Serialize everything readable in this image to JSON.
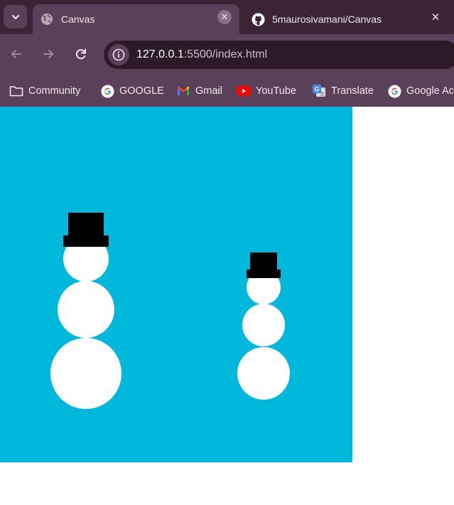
{
  "browser": {
    "tab_search_icon": "chevron-down-icon",
    "tabs": [
      {
        "title": "Canvas",
        "icon": "globe-icon",
        "active": true
      },
      {
        "title": "5maurosivamani/Canvas",
        "icon": "github-icon",
        "active": false
      }
    ],
    "toolbar": {
      "url_host": "127.0.0.1",
      "url_rest": ":5500/index.html"
    },
    "bookmarks": [
      {
        "label": "Community",
        "icon": "folder-icon"
      },
      {
        "label": "GOOGLE",
        "icon": "google-icon"
      },
      {
        "label": "Gmail",
        "icon": "gmail-icon"
      },
      {
        "label": "YouTube",
        "icon": "youtube-icon"
      },
      {
        "label": "Translate",
        "icon": "translate-icon"
      },
      {
        "label": "Google Ac",
        "icon": "google-icon"
      }
    ]
  },
  "page": {
    "canvas_color": "#00b7dc",
    "scene": "two snowmen with black top hats"
  },
  "colors": {
    "tab_strip": "#3a2436",
    "toolbar": "#5a4058",
    "omnibox": "#2c1a29",
    "snow": "#ffffff",
    "hat": "#000000"
  }
}
